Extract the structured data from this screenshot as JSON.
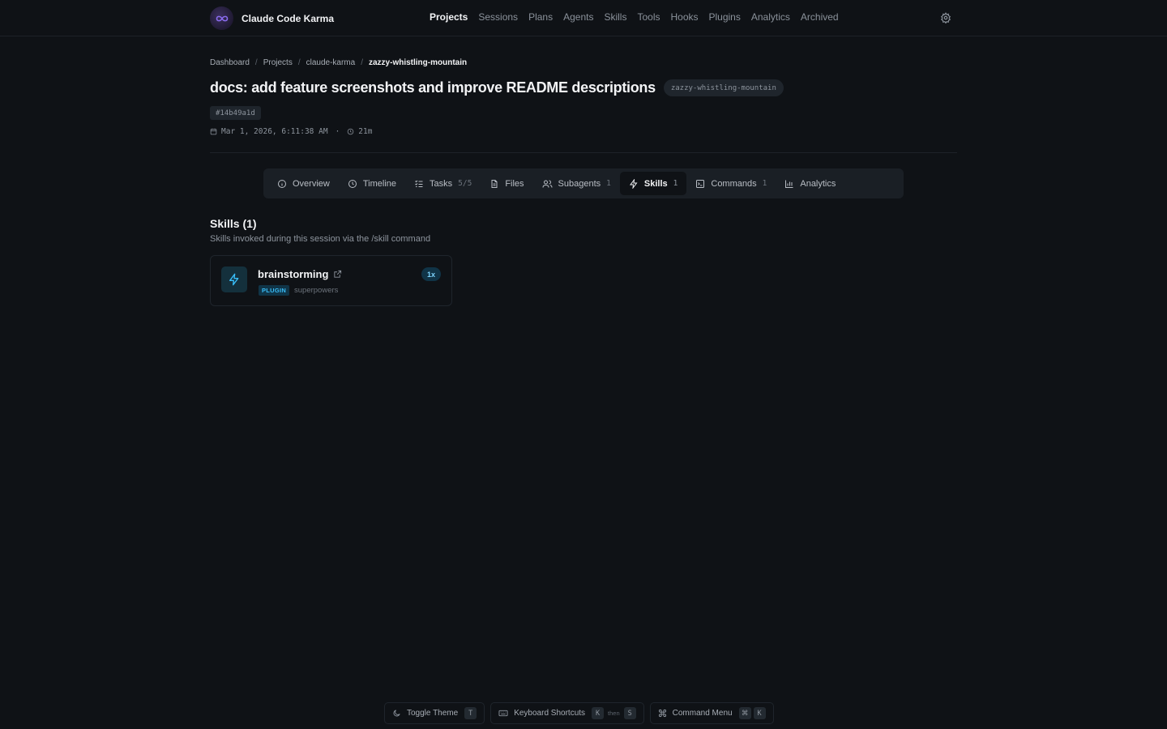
{
  "app": {
    "name": "Claude Code Karma"
  },
  "nav": {
    "items": [
      "Projects",
      "Sessions",
      "Plans",
      "Agents",
      "Skills",
      "Tools",
      "Hooks",
      "Plugins",
      "Analytics",
      "Archived"
    ],
    "active": "Projects"
  },
  "breadcrumb": [
    "Dashboard",
    "Projects",
    "claude-karma",
    "zazzy-whistling-mountain"
  ],
  "session": {
    "title": "docs: add feature screenshots and improve README descriptions",
    "slug": "zazzy-whistling-mountain",
    "hash": "#14b49a1d",
    "date": "Mar 1, 2026, 6:11:38 AM",
    "separator": "·",
    "duration": "21m"
  },
  "tabs": [
    {
      "label": "Overview",
      "count": "",
      "icon": "info-icon"
    },
    {
      "label": "Timeline",
      "count": "",
      "icon": "clock-icon"
    },
    {
      "label": "Tasks",
      "count": "5/5",
      "icon": "tasks-icon"
    },
    {
      "label": "Files",
      "count": "",
      "icon": "file-icon"
    },
    {
      "label": "Subagents",
      "count": "1",
      "icon": "users-icon"
    },
    {
      "label": "Skills",
      "count": "1",
      "icon": "zap-icon",
      "active": true
    },
    {
      "label": "Commands",
      "count": "1",
      "icon": "terminal-icon"
    },
    {
      "label": "Analytics",
      "count": "",
      "icon": "bar-chart-icon"
    }
  ],
  "skills_section": {
    "title": "Skills (1)",
    "subtitle": "Skills invoked during this session via the /skill command",
    "items": [
      {
        "name": "brainstorming",
        "badge": "PLUGIN",
        "source": "superpowers",
        "uses": "1x",
        "icon": "zap-icon"
      }
    ]
  },
  "shortcuts": {
    "toggle_theme": {
      "label": "Toggle Theme",
      "keys": [
        "T"
      ]
    },
    "keyboard_shortcuts": {
      "label": "Keyboard Shortcuts",
      "keys": [
        "K",
        "S"
      ],
      "joiner": "then"
    },
    "command_menu": {
      "label": "Command Menu",
      "keys": [
        "⌘",
        "K"
      ]
    }
  },
  "colors": {
    "background": "#0f1216",
    "accent": "#38bdf8",
    "text": "#f2f3f5"
  }
}
